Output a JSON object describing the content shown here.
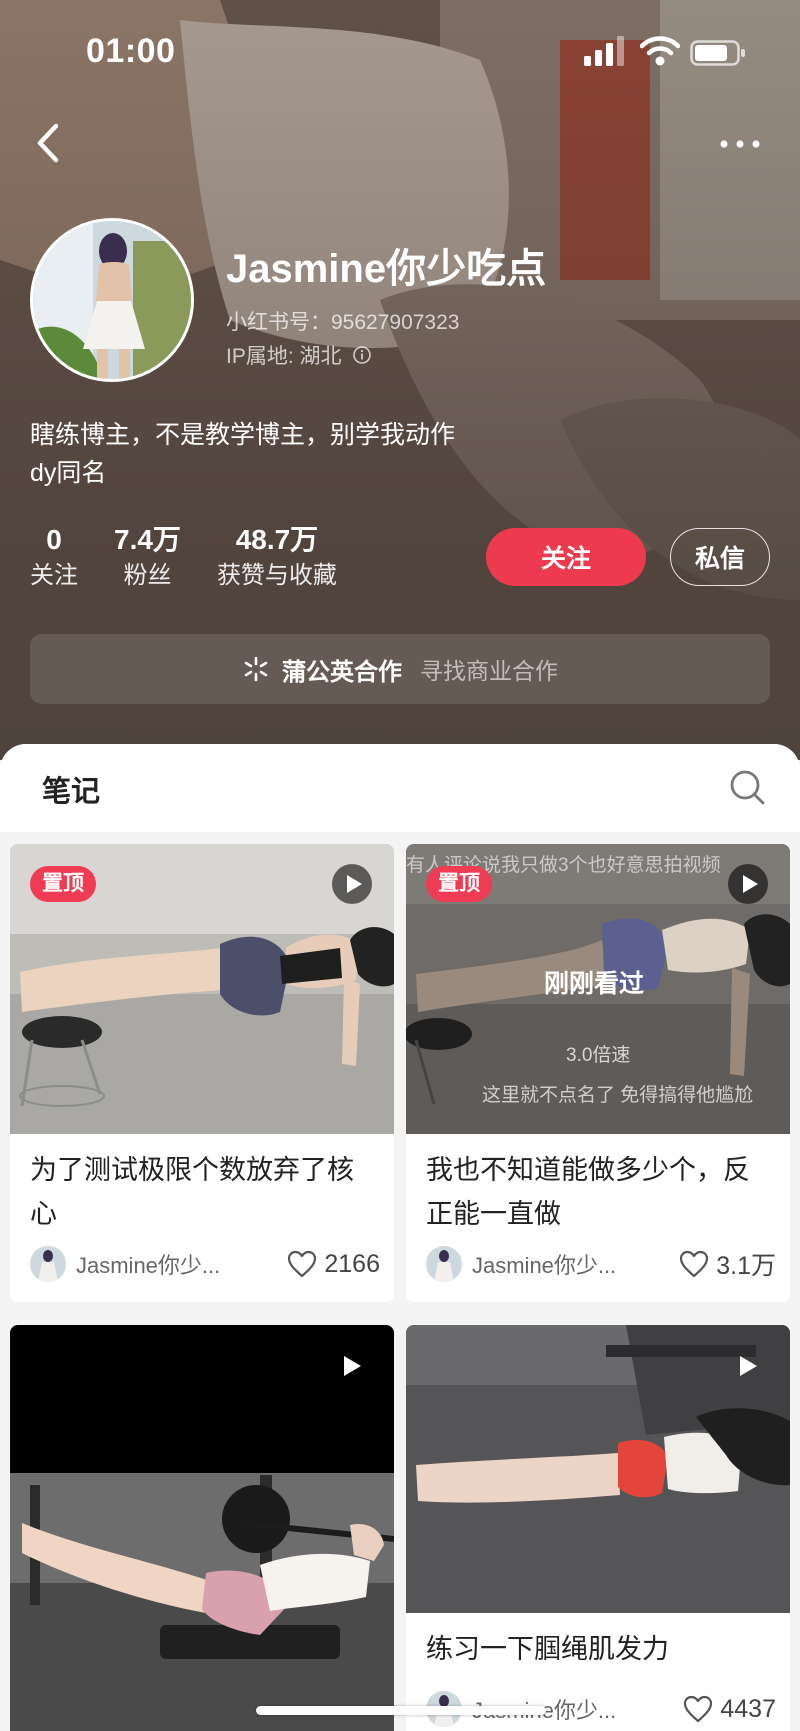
{
  "status_bar": {
    "time": "01:00"
  },
  "profile": {
    "name": "Jasmine你少吃点",
    "red_id": "小红书号：95627907323",
    "ip_location": "IP属地: 湖北",
    "bio_line1": "瞎练博主，不是教学博主，别学我动作",
    "bio_line2": "dy同名"
  },
  "stats": [
    {
      "value": "0",
      "label": "关注"
    },
    {
      "value": "7.4万",
      "label": "粉丝"
    },
    {
      "value": "48.7万",
      "label": "获赞与收藏"
    }
  ],
  "actions": {
    "follow": "关注",
    "message": "私信"
  },
  "cooperation": {
    "title": "蒲公英合作",
    "subtitle": "寻找商业合作"
  },
  "tabs": {
    "notes": "笔记"
  },
  "notes": [
    {
      "pinned_label": "置顶",
      "title": "为了测试极限个数放弃了核心",
      "author": "Jasmine你少...",
      "likes": "2166",
      "icon": "play-icon"
    },
    {
      "pinned_label": "置顶",
      "title": "我也不知道能做多少个，反正能一直做",
      "author": "Jasmine你少...",
      "likes": "3.1万",
      "icon": "play-icon",
      "overlay_top": "有人评论说我只做3个也好意思拍视频",
      "overlay_center": "刚刚看过",
      "overlay_speed": "3.0倍速",
      "overlay_bottom": "这里就不点名了 免得搞得他尴尬"
    },
    {
      "title": "",
      "author": "",
      "likes": "",
      "icon": "play-icon"
    },
    {
      "title": "练习一下腘绳肌发力",
      "author": "Jasmine你少...",
      "likes": "4437",
      "icon": "play-icon"
    }
  ],
  "colors": {
    "accent": "#ee3a4f",
    "pin": "#ef3b53"
  }
}
